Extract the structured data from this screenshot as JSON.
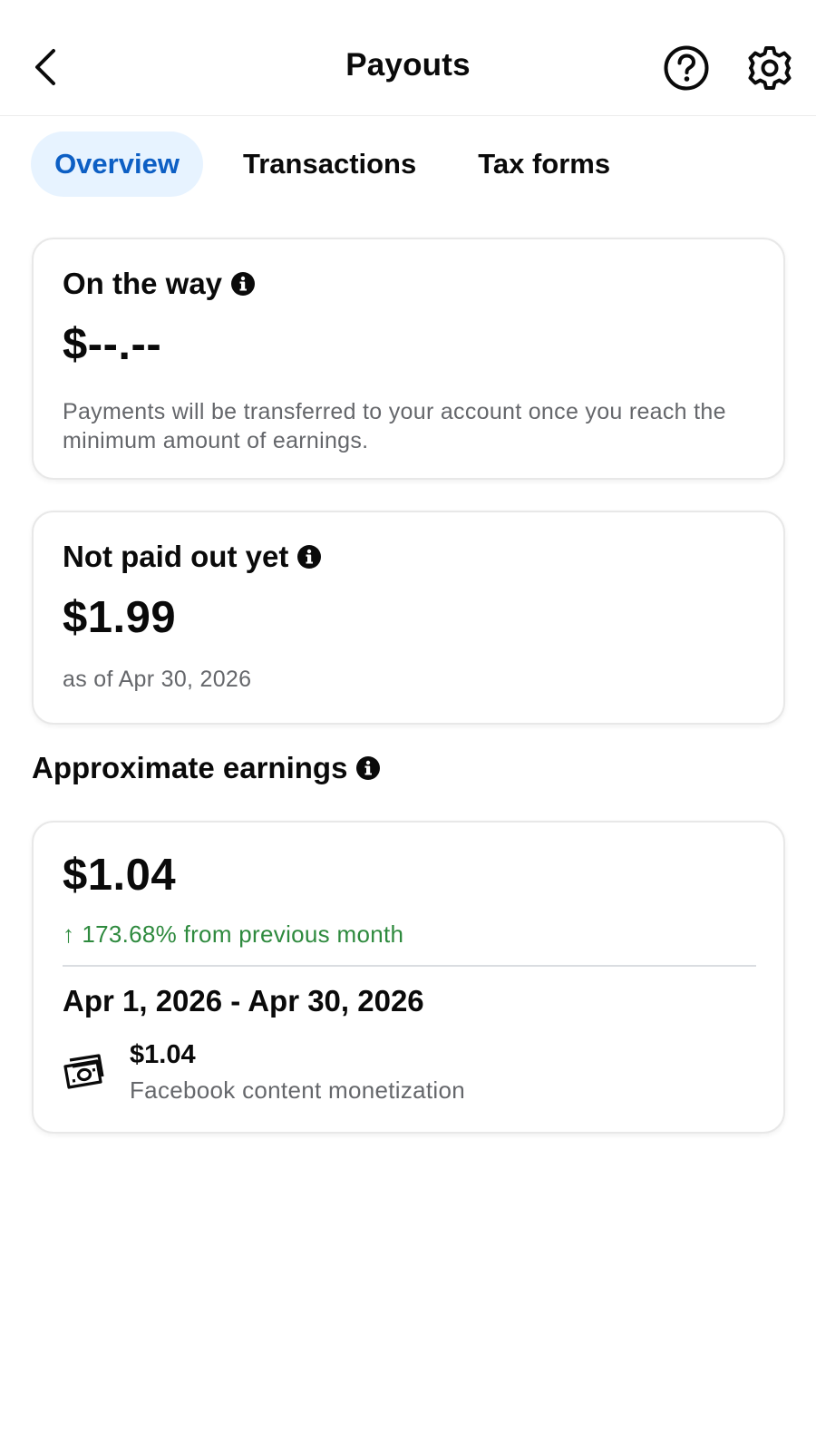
{
  "header": {
    "title": "Payouts",
    "back_icon": "chevron-left-icon",
    "help_icon": "question-circle-icon",
    "settings_icon": "gear-icon"
  },
  "tabs": [
    {
      "label": "Overview",
      "active": true
    },
    {
      "label": "Transactions",
      "active": false
    },
    {
      "label": "Tax forms",
      "active": false
    }
  ],
  "on_the_way": {
    "heading": "On the way",
    "amount": "$--.--",
    "description": "Payments will be transferred to your account once you reach the minimum amount of earnings."
  },
  "not_paid_out": {
    "heading": "Not paid out yet",
    "amount": "$1.99",
    "as_of": "as of Apr 30, 2026"
  },
  "approximate_earnings": {
    "heading": "Approximate earnings",
    "amount": "$1.04",
    "change_arrow": "↑",
    "change_text": "173.68% from previous month",
    "date_range": "Apr 1, 2026 - Apr 30, 2026",
    "items": [
      {
        "icon": "money-bill-icon",
        "amount": "$1.04",
        "source": "Facebook content monetization"
      }
    ]
  },
  "colors": {
    "accent_blue": "#0d5fc4",
    "active_tab_bg": "#e7f3ff",
    "positive_green": "#2e8a3e",
    "secondary_text": "#65676b"
  }
}
